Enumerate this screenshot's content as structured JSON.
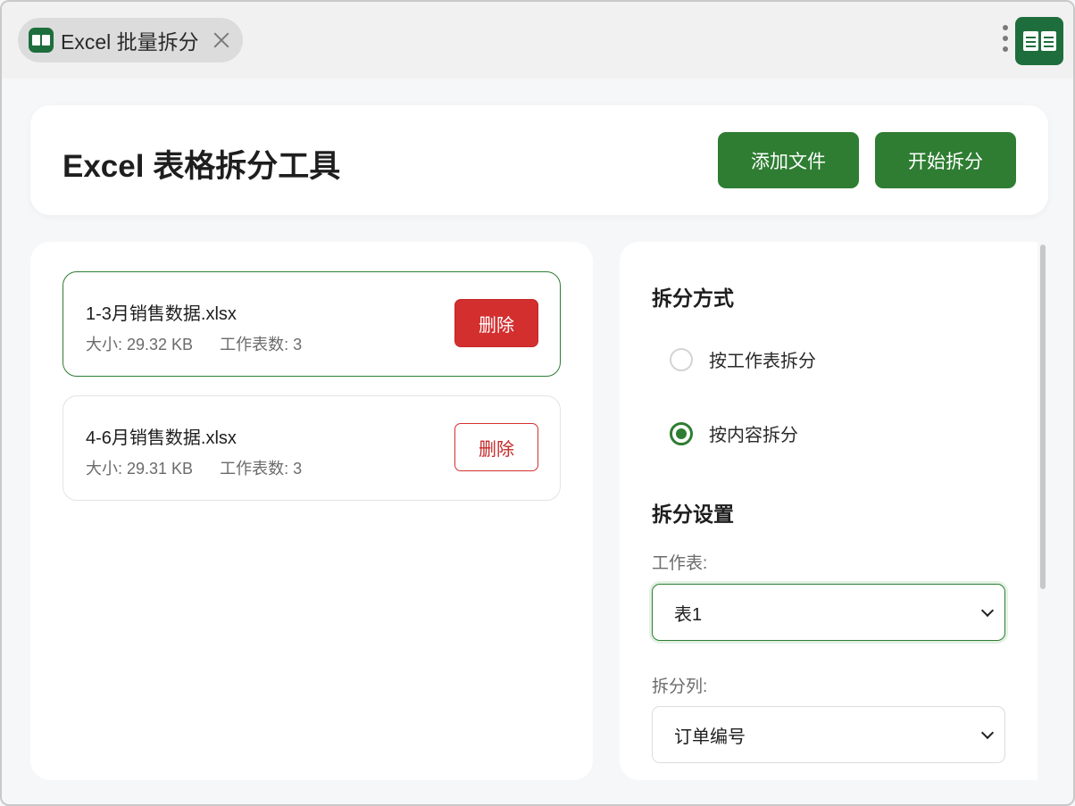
{
  "tab": {
    "title": "Excel 批量拆分"
  },
  "header": {
    "title": "Excel 表格拆分工具",
    "add_label": "添加文件",
    "start_label": "开始拆分"
  },
  "files": [
    {
      "name": "1-3月销售数据.xlsx",
      "meta": "大小: 29.32 KB      工作表数: 3",
      "delete_label": "删除"
    },
    {
      "name": "4-6月销售数据.xlsx",
      "meta": "大小: 29.31 KB      工作表数: 3",
      "delete_label": "删除"
    }
  ],
  "settings": {
    "mode_title": "拆分方式",
    "mode_options": [
      {
        "label": "按工作表拆分",
        "checked": false
      },
      {
        "label": "按内容拆分",
        "checked": true
      }
    ],
    "settings_title": "拆分设置",
    "sheet_label": "工作表:",
    "sheet_value": "表1",
    "column_label": "拆分列:",
    "column_value": "订单编号"
  },
  "colors": {
    "accent": "#2e7d32",
    "danger": "#d32f2f"
  }
}
